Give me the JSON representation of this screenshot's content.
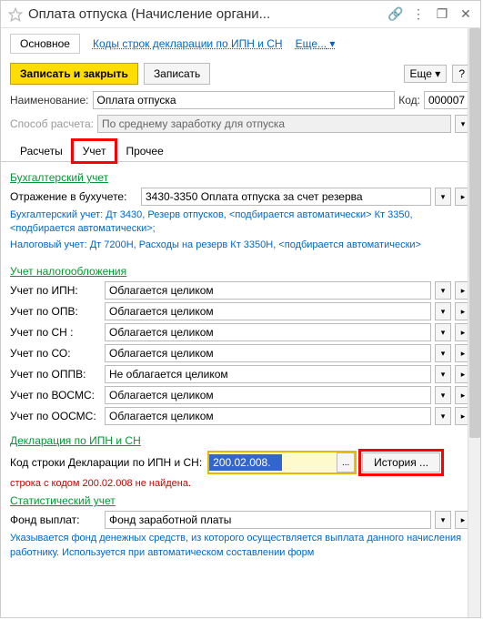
{
  "title": "Оплата отпуска (Начисление органи...",
  "nav": {
    "main": "Основное",
    "link1": "Коды строк декларации по ИПН и СН",
    "more": "Еще..."
  },
  "toolbar": {
    "save_close": "Записать и закрыть",
    "save": "Записать",
    "more": "Еще",
    "help": "?"
  },
  "name": {
    "label": "Наименование:",
    "value": "Оплата отпуска",
    "code_label": "Код:",
    "code_value": "000007"
  },
  "method": {
    "label": "Способ расчета:",
    "value": "По среднему заработку для отпуска"
  },
  "tabs": {
    "t1": "Расчеты",
    "t2": "Учет",
    "t3": "Прочее"
  },
  "acct": {
    "title": "Бухгалтерский учет",
    "label": "Отражение в бухучете:",
    "value": "3430-3350 Оплата отпуска за счет резерва",
    "note1": "Бухгалтерский учет: Дт 3430, Резерв отпусков, <подбирается автоматически> Кт 3350, <подбирается автоматически>;",
    "note2": "Налоговый учет: Дт 7200Н, Расходы на резерв Кт 3350Н, <подбирается автоматически>"
  },
  "tax": {
    "title": "Учет налогообложения",
    "rows": [
      {
        "label": "Учет по ИПН:",
        "value": "Облагается целиком"
      },
      {
        "label": "Учет по ОПВ:",
        "value": "Облагается целиком"
      },
      {
        "label": "Учет по СН :",
        "value": "Облагается целиком"
      },
      {
        "label": "Учет по СО:",
        "value": "Облагается целиком"
      },
      {
        "label": "Учет по ОППВ:",
        "value": "Не облагается целиком"
      },
      {
        "label": "Учет по ВОСМС:",
        "value": "Облагается целиком"
      },
      {
        "label": "Учет по ООСМС:",
        "value": "Облагается целиком"
      }
    ]
  },
  "decl": {
    "title": "Декларация по ИПН и СН",
    "label": "Код строки Декларации по ИПН и СН:",
    "value": "200.02.008.",
    "history": "История ...",
    "error": "строка с кодом 200.02.008 не найдена."
  },
  "stat": {
    "title": "Статистический учет",
    "label": "Фонд выплат:",
    "value": "Фонд заработной платы",
    "note": "Указывается фонд денежных средств, из которого осуществляется выплата данного начисления работнику. Используется при автоматическом составлении форм"
  }
}
